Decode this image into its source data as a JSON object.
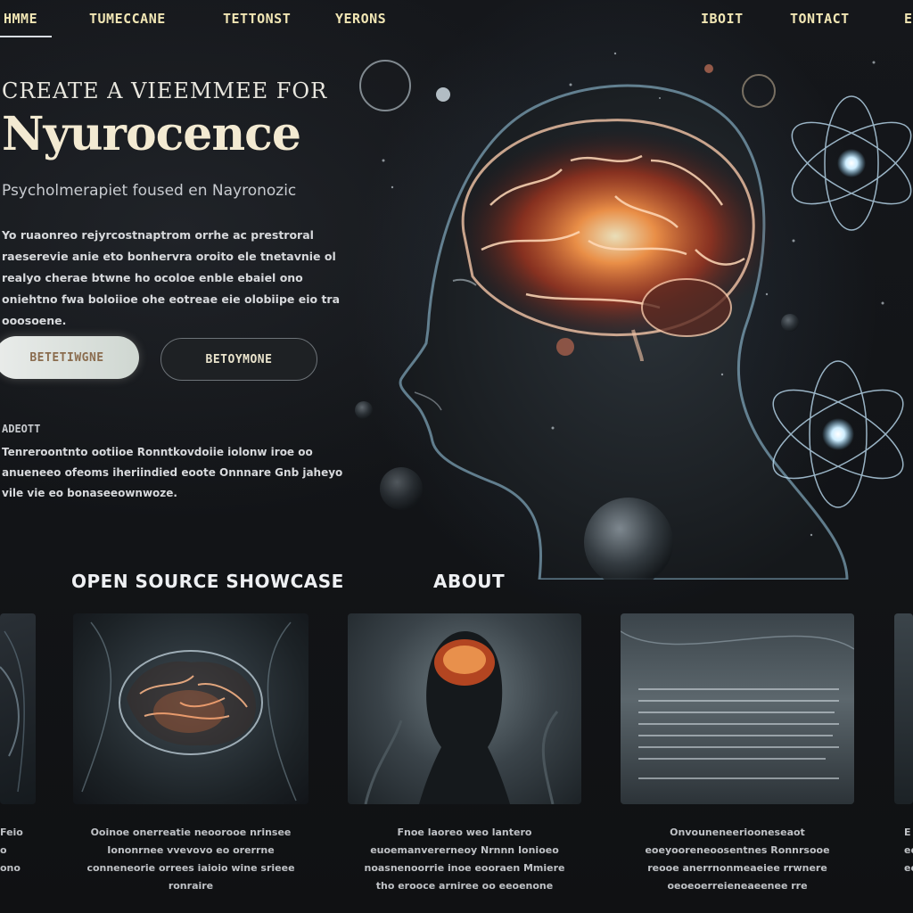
{
  "nav": {
    "items": [
      "HMME",
      "TUMECCANE",
      "TETTONST",
      "YERONS",
      "IBOIT",
      "TONTACT"
    ],
    "edge_item": "E"
  },
  "hero": {
    "kicker": "CREATE A VIEEMMEE FOR",
    "title": "Nyurocence",
    "tagline": "Psycholmerapiet foused en Nayronozic",
    "paragraph": "Yo ruaonreo rejyrcostnaptrom orrhe ac prestroral raeserevie anie eto bonhervra oroito ele tnetavnie ol realyo cherae btwne ho ocoloe enble ebaiel ono oniehtno fwa boloiioe ohe eotreae eie olobiipe eio tra ooosoene.",
    "primary_button": "BETETIWGNE",
    "secondary_button": "BETOYMONE"
  },
  "about_block": {
    "label": "ADEOTT",
    "text": "Tenreroontnto ootiioe Ronntkovdoiie iolonw iroe oo anueneeo ofeoms iheriindied eoote Onnnare Gnb jaheyo vile vie eo bonaseeownwoze."
  },
  "sections": {
    "left": "OPEN SOURCE SHOWCASE",
    "right": "ABOUT"
  },
  "cards": [
    {
      "caption": "Feio o ono oo"
    },
    {
      "caption": "Ooinoe onerreatie neoorooe nrinsee Iononrnee vvevovo eo orerrne conneneorie orrees iaioio wine srieee ronraire"
    },
    {
      "caption": "Fnoe laoreo weo lantero euoemanvererneoy Nrnnn Ionioeo noasnenoorrie inoe eooraen Mmiere tho erooce arniree oo eeoenone"
    },
    {
      "caption": "Onvouneneeriooneseaot eoeyooreneoosentnes Ronnrsooe reooe anerrnonmeaeiee rrwnere oeoeoerreieneaeenee rre"
    },
    {
      "caption": "E eo ee"
    }
  ],
  "colors": {
    "background": "#121417",
    "nav_text": "#f1e6b4",
    "brain_glow": "#ff7a3a",
    "accent_blue": "#8fd6ff"
  }
}
